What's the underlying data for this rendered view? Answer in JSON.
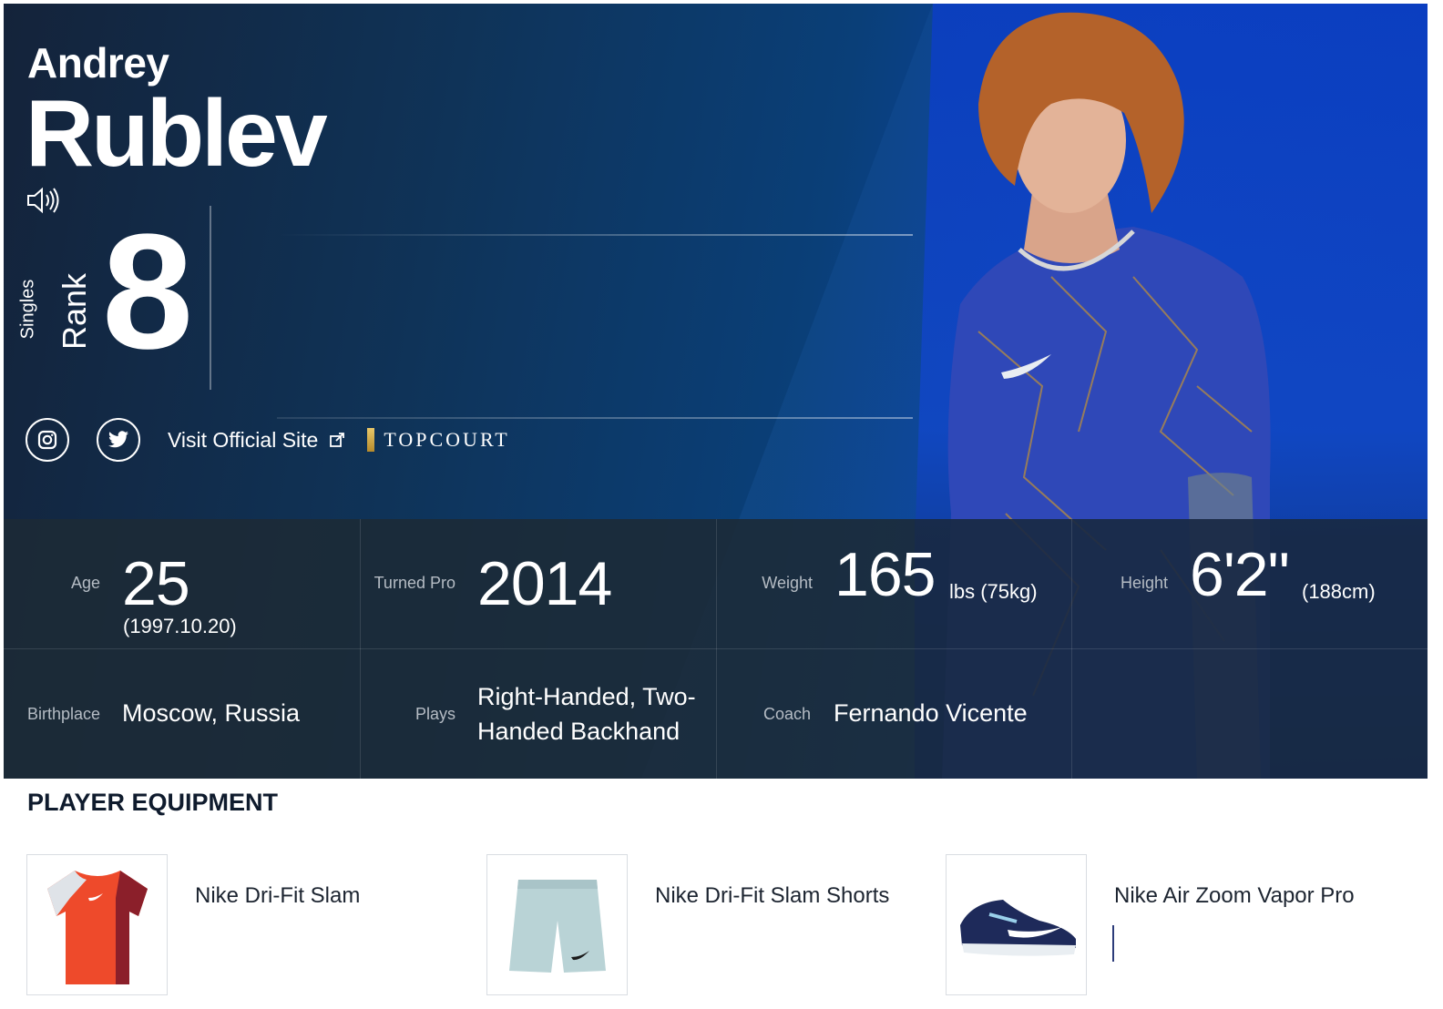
{
  "player": {
    "first_name": "Andrey",
    "last_name": "Rublev"
  },
  "rank": {
    "category": "Singles",
    "label": "Rank",
    "value": "8"
  },
  "links": {
    "visit_official_site": "Visit Official Site",
    "sponsor": "TOPCOURT"
  },
  "stats": {
    "age": {
      "label": "Age",
      "value": "25",
      "sub": "(1997.10.20)"
    },
    "turned_pro": {
      "label": "Turned Pro",
      "value": "2014"
    },
    "weight": {
      "label": "Weight",
      "value": "165",
      "unit": "lbs (75kg)"
    },
    "height": {
      "label": "Height",
      "value": "6'2\"",
      "unit": "(188cm)"
    },
    "birthplace": {
      "label": "Birthplace",
      "value": "Moscow, Russia"
    },
    "plays": {
      "label": "Plays",
      "line1": "Right-Handed, Two-",
      "line2": "Handed Backhand"
    },
    "coach": {
      "label": "Coach",
      "value": "Fernando Vicente"
    }
  },
  "equipment": {
    "title": "PLAYER EQUIPMENT",
    "items": [
      {
        "name": "Nike Dri-Fit Slam"
      },
      {
        "name": "Nike Dri-Fit Slam Shorts"
      },
      {
        "name": "Nike Air Zoom Vapor Pro"
      }
    ]
  },
  "icons": [
    "speaker-icon",
    "instagram-icon",
    "twitter-icon",
    "external-link-icon"
  ],
  "colors": {
    "hero_dark": "#14233a",
    "hero_blue": "#0b46b4",
    "panel": "#1c2a36",
    "title": "#0f1b2d"
  }
}
